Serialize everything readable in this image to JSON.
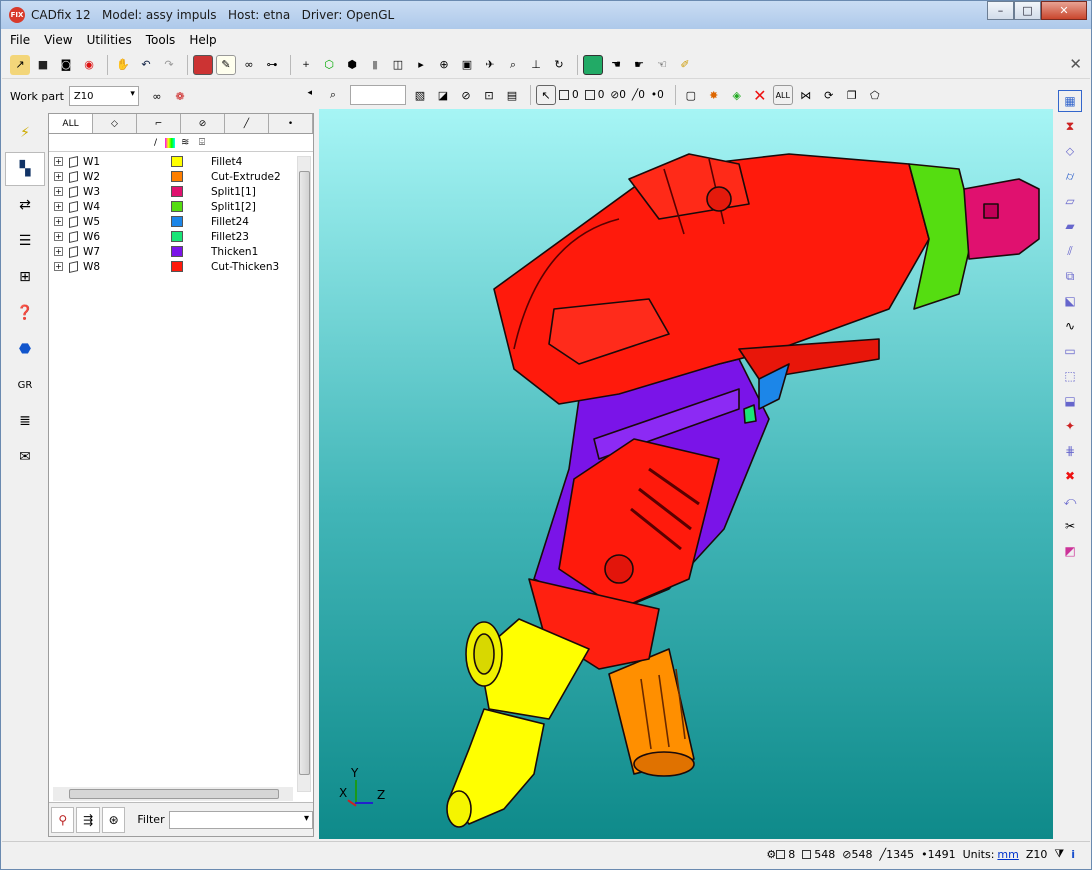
{
  "window": {
    "title": "CADfix 12   Model: assy impuls   Host: etna   Driver: OpenGL",
    "logo": "FIX",
    "controls": [
      "–",
      "□",
      "✕"
    ]
  },
  "menu": [
    "File",
    "View",
    "Utilities",
    "Tools",
    "Help"
  ],
  "workpart": {
    "label": "Work part",
    "value": "Z10"
  },
  "panel_tabs": [
    "ALL",
    "face-icon",
    "edge-icon",
    "pipe-icon",
    "line-icon",
    "point-icon"
  ],
  "tree": {
    "columns": {
      "name": "",
      "visibility": "/"
    },
    "rows": [
      {
        "name": "W1",
        "color": "#ffff00",
        "label": "Fillet4"
      },
      {
        "name": "W2",
        "color": "#ff7f00",
        "label": "Cut-Extrude2"
      },
      {
        "name": "W3",
        "color": "#e0116f",
        "label": "Split1[1]"
      },
      {
        "name": "W4",
        "color": "#55dd11",
        "label": "Split1[2]"
      },
      {
        "name": "W5",
        "color": "#1c86e8",
        "label": "Fillet24"
      },
      {
        "name": "W6",
        "color": "#19e577",
        "label": "Fillet23"
      },
      {
        "name": "W7",
        "color": "#7a14e8",
        "label": "Thicken1"
      },
      {
        "name": "W8",
        "color": "#ff1a0c",
        "label": "Cut-Thicken3"
      }
    ]
  },
  "filter": {
    "label": "Filter",
    "value": ""
  },
  "counts": {
    "solids": "0",
    "faces": "0",
    "edges": "0",
    "lines": "0",
    "points": "0"
  },
  "view_toolbar": {
    "all_label": "ALL"
  },
  "axes": {
    "x": "X",
    "y": "Y",
    "z": "Z"
  },
  "status": {
    "bodies": "8",
    "faces": "548",
    "shells": "548",
    "edges": "1345",
    "points": "1491",
    "units_label": "Units:",
    "units": "mm",
    "part": "Z10",
    "info": "i"
  },
  "left_tab_gr": "GR"
}
